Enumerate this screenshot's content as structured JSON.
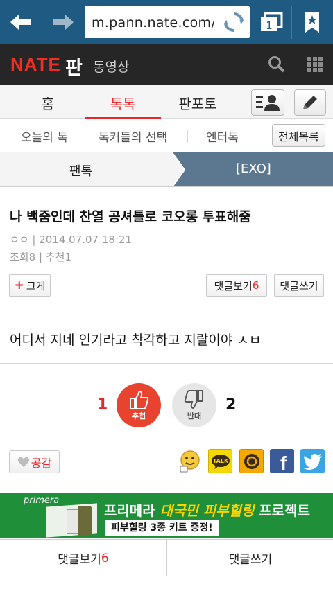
{
  "browser": {
    "url": "m.pann.nate.com/ta",
    "tab_count": "1"
  },
  "site": {
    "logo": "NATE",
    "section": "판",
    "video_link": "동영상"
  },
  "main_tabs": [
    {
      "label": "홈",
      "active": false
    },
    {
      "label": "톡톡",
      "active": true
    },
    {
      "label": "판포토",
      "active": false
    }
  ],
  "sub_tabs": [
    {
      "label": "오늘의 톡"
    },
    {
      "label": "톡커들의 선택"
    },
    {
      "label": "엔터톡"
    }
  ],
  "all_list_label": "전체목록",
  "breadcrumb": {
    "parent": "팬톡",
    "current": "[EXO]"
  },
  "article": {
    "title": "나 백줌인데 찬열 공셔틀로 코오롱 투표해줌",
    "author": "ㅇㅇ",
    "date": "2014.07.07 18:21",
    "views_label": "조회",
    "views": "8",
    "recommend_label": "추천",
    "recommend": "1",
    "body": "어디서 지네 인기라고 착각하고 지랄이야 ㅅㅂ"
  },
  "buttons": {
    "enlarge": "크게",
    "view_comments": "댓글보기",
    "comment_count": "6",
    "write_comment": "댓글쓰기",
    "like": "공감"
  },
  "votes": {
    "up_count": "1",
    "up_label": "추천",
    "down_count": "2",
    "down_label": "반대"
  },
  "share": [
    "emoticon-icon",
    "kakaotalk-icon",
    "kakaostory-icon",
    "facebook-icon",
    "twitter-icon"
  ],
  "banner": {
    "brand": "primera",
    "title_prefix": "프리메라",
    "title_accent": "대국민 피부힐링",
    "title_suffix": "프로젝트",
    "subtitle": "피부힐링 3종 키트 증정!"
  },
  "colors": {
    "brand_red": "#e8262b",
    "browser_blue": "#1f5a82",
    "header_dark": "#262626",
    "crumb_blue": "#5c7890",
    "banner_green": "#1f8f3a"
  }
}
